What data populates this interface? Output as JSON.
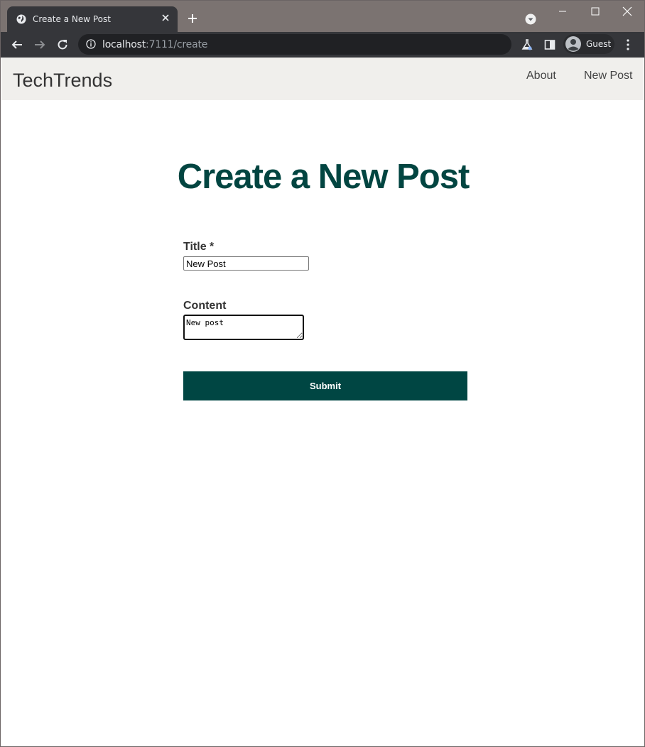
{
  "browser": {
    "tab_title": "Create a New Post",
    "url_host": "localhost",
    "url_path": ":7111/create",
    "profile_label": "Guest"
  },
  "site": {
    "brand": "TechTrends",
    "nav": {
      "about": "About",
      "new_post": "New Post"
    }
  },
  "form": {
    "heading": "Create a New Post",
    "title_label": "Title *",
    "title_value": "New Post",
    "content_label": "Content",
    "content_value": "New post",
    "submit_label": "Submit"
  },
  "colors": {
    "accent": "#004643",
    "heading": "#024541",
    "navbar_bg": "#f0efec"
  },
  "icons": [
    "globe-icon",
    "close-icon",
    "plus-icon",
    "chevron-down-icon",
    "back-icon",
    "forward-icon",
    "reload-icon",
    "info-icon",
    "flask-icon",
    "side-panel-icon",
    "avatar-icon",
    "kebab-menu-icon"
  ]
}
